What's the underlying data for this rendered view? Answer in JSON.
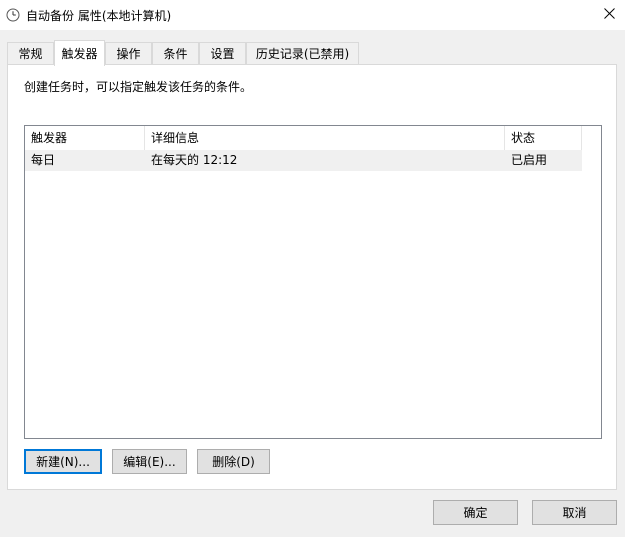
{
  "window": {
    "title": "自动备份 属性(本地计算机)"
  },
  "tabs": [
    {
      "label": "常规"
    },
    {
      "label": "触发器"
    },
    {
      "label": "操作"
    },
    {
      "label": "条件"
    },
    {
      "label": "设置"
    },
    {
      "label": "历史记录(已禁用)"
    }
  ],
  "active_tab": "触发器",
  "triggers_panel": {
    "description": "创建任务时，可以指定触发该任务的条件。",
    "columns": [
      "触发器",
      "详细信息",
      "状态"
    ],
    "rows": [
      {
        "trigger": "每日",
        "details": "在每天的 12:12",
        "status": "已启用"
      }
    ],
    "buttons": {
      "new": "新建(N)...",
      "edit": "编辑(E)...",
      "delete": "删除(D)"
    }
  },
  "footer": {
    "ok": "确定",
    "cancel": "取消"
  },
  "colors": {
    "accent": "#0078d7",
    "row_bg": "#f0f0f0",
    "window_bg": "#f0f0f0"
  },
  "icons": {
    "title": "clock-icon",
    "close": "close-icon"
  }
}
